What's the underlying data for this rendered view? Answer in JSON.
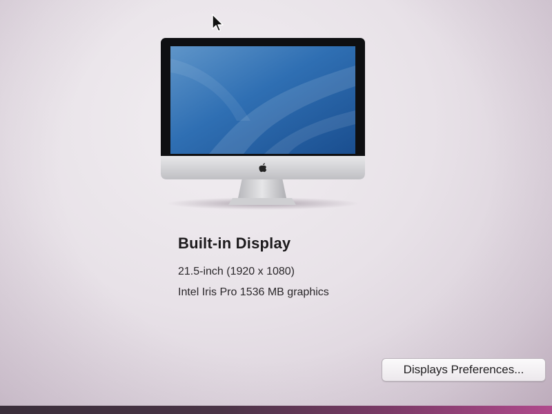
{
  "display": {
    "title": "Built-in Display",
    "size": "21.5-inch (1920 x 1080)",
    "graphics": "Intel Iris Pro 1536 MB graphics"
  },
  "actions": {
    "preferences_button": "Displays Preferences..."
  },
  "icons": {
    "device": "imac-icon",
    "logo": "apple-logo-icon",
    "pointer": "mouse-cursor-icon"
  },
  "colors": {
    "screen_blue": "#2f6fb3",
    "background": "#ebe5eb"
  }
}
